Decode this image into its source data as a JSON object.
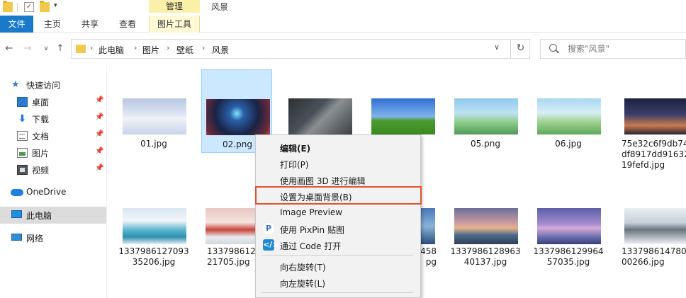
{
  "title": {
    "manage_tab": "管理",
    "folder_name": "风景"
  },
  "ribbon": {
    "tabs": [
      "文件",
      "主页",
      "共享",
      "查看",
      "图片工具"
    ]
  },
  "address": {
    "crumbs": [
      "此电脑",
      "图片",
      "壁纸",
      "风景"
    ],
    "separator": "›",
    "search_placeholder": "搜索\"风景\""
  },
  "sidebar": {
    "items": [
      {
        "label": "快速访问",
        "icon": "star-icon",
        "pinned": false
      },
      {
        "label": "桌面",
        "icon": "desktop-icon",
        "pinned": true
      },
      {
        "label": "下载",
        "icon": "download-icon",
        "pinned": true
      },
      {
        "label": "文档",
        "icon": "document-icon",
        "pinned": true
      },
      {
        "label": "图片",
        "icon": "picture-icon",
        "pinned": true
      },
      {
        "label": "视频",
        "icon": "video-icon",
        "pinned": true
      },
      {
        "label": "OneDrive",
        "icon": "cloud-icon",
        "pinned": false
      },
      {
        "label": "此电脑",
        "icon": "computer-icon",
        "pinned": false
      },
      {
        "label": "网络",
        "icon": "network-icon",
        "pinned": false
      }
    ]
  },
  "files": {
    "row1": [
      {
        "name": "01.jpg"
      },
      {
        "name": "02.png",
        "selected": true
      },
      {
        "name": ""
      },
      {
        "name": ""
      },
      {
        "name": "05.png"
      },
      {
        "name": "06.jpg"
      },
      {
        "name": "75e32c6f9db74df8917dd9163219fefd.jpg",
        "lines": [
          "75e32c6f9db74",
          "df8917dd91632",
          "19fefd.jpg"
        ]
      }
    ],
    "row2": [
      {
        "name": "133798612709335206.jpg",
        "lines": [
          "1337986127093",
          "35206.jpg"
        ]
      },
      {
        "name": "133798612721705.jpg",
        "lines": [
          "133798612",
          "21705.jpg"
        ]
      },
      {
        "name": ""
      },
      {
        "name": "",
        "lines": [
          "458",
          "pg"
        ]
      },
      {
        "name": "133798612896340137.jpg",
        "lines": [
          "1337986128963",
          "40137.jpg"
        ]
      },
      {
        "name": "133798612996457035.jpg",
        "lines": [
          "1337986129964",
          "57035.jpg"
        ]
      },
      {
        "name": "133798614780700266.jpg",
        "lines": [
          "1337986147807",
          "00266.jpg"
        ]
      }
    ]
  },
  "context_menu": {
    "items": [
      {
        "label": "编辑(E)",
        "bold": true
      },
      {
        "label": "打印(P)"
      },
      {
        "label": "使用画图 3D 进行编辑"
      },
      {
        "label": "设置为桌面背景(B)",
        "highlighted": true
      },
      {
        "label": "Image Preview"
      },
      {
        "label": "使用 PixPin 贴图",
        "icon": "pixpin-icon"
      },
      {
        "label": "通过 Code 打开",
        "icon": "vscode-icon"
      },
      {
        "label": "向右旋转(T)"
      },
      {
        "label": "向左旋转(L)"
      }
    ]
  },
  "colors": {
    "accent": "#1979ca",
    "selection": "#cce8ff",
    "highlight_border": "#e25330"
  }
}
